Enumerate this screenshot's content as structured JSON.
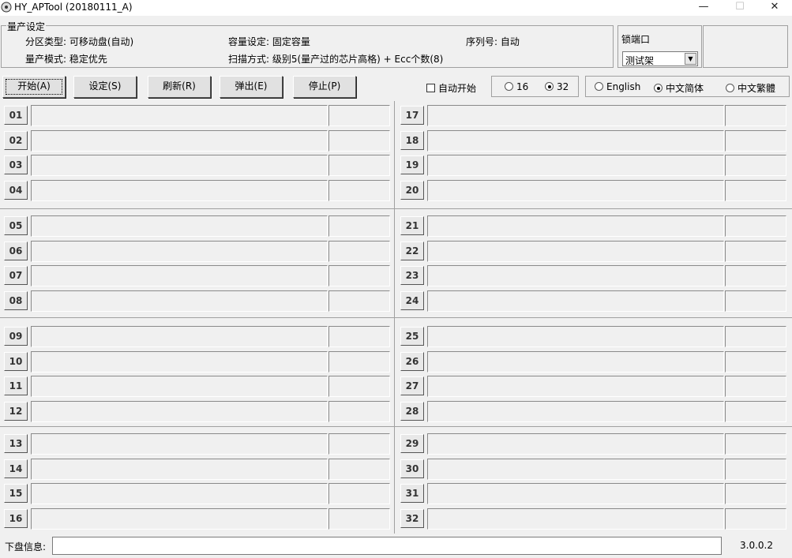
{
  "window": {
    "title": "HY_APTool (20180111_A)",
    "minimize": "—",
    "maximize": "☐",
    "close": "✕"
  },
  "settings": {
    "group_label": "量产设定",
    "partition_type": "分区类型: 可移动盘(自动)",
    "mode": "量产模式: 稳定优先",
    "capacity": "容量设定: 固定容量",
    "scan": "扫描方式: 级别5(量产过的芯片高格) + Ecc个数(8)",
    "serial": "序列号: 自动"
  },
  "port": {
    "label": "锁端口",
    "selected": "测试架",
    "arrow": "▼"
  },
  "toolbar": {
    "start": "开始(A)",
    "settings": "设定(S)",
    "refresh": "刷新(R)",
    "eject": "弹出(E)",
    "stop": "停止(P)",
    "auto_start": "自动开始",
    "opt16": "16",
    "opt32": "32",
    "lang_en": "English",
    "lang_sc": "中文简体",
    "lang_tc": "中文繁體"
  },
  "slots": [
    "01",
    "02",
    "03",
    "04",
    "05",
    "06",
    "07",
    "08",
    "09",
    "10",
    "11",
    "12",
    "13",
    "14",
    "15",
    "16",
    "17",
    "18",
    "19",
    "20",
    "21",
    "22",
    "23",
    "24",
    "25",
    "26",
    "27",
    "28",
    "29",
    "30",
    "31",
    "32"
  ],
  "footer": {
    "label": "下盘信息:",
    "version": "3.0.0.2"
  }
}
